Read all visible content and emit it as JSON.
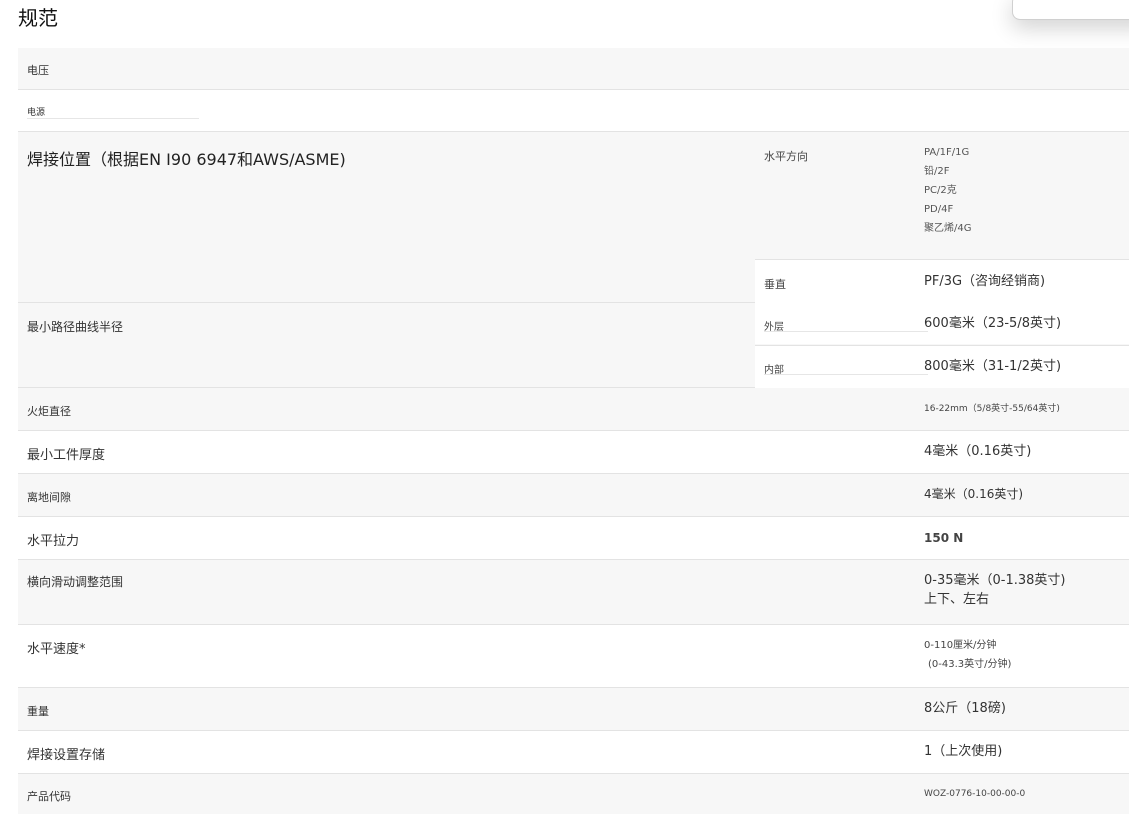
{
  "page": {
    "title": "规范"
  },
  "rows": {
    "voltage": {
      "label": "电压"
    },
    "power": {
      "label": "电源"
    },
    "welding_position": {
      "label": "焊接位置（根据EN I90 6947和AWS/ASME)",
      "horizontal": {
        "sub_label": "水平方向",
        "values": [
          "PA/1F/1G",
          "铅/2F",
          "PC/2克",
          "PD/4F",
          "聚乙烯/4G"
        ]
      },
      "vertical": {
        "sub_label": "垂直",
        "value": "PF/3G（咨询经销商)"
      }
    },
    "min_path_radius": {
      "label": "最小路径曲线半径",
      "outer": {
        "sub_label": "外层",
        "value": "600毫米（23-5/8英寸)"
      },
      "inner": {
        "sub_label": "内部",
        "value": "800毫米（31-1/2英寸)"
      }
    },
    "torch_diameter": {
      "label": "火炬直径",
      "value": "16-22mm（5/8英寸-55/64英寸)"
    },
    "min_workpiece_thickness": {
      "label": "最小工件厚度",
      "value": "4毫米（0.16英寸)"
    },
    "ground_clearance": {
      "label": "离地间隙",
      "value": "4毫米（0.16英寸)"
    },
    "horizontal_pull": {
      "label": "水平拉力",
      "value": "150 N"
    },
    "cross_slide_range": {
      "label": "横向滑动调整范围",
      "value_line1": "0-35毫米（0-1.38英寸)",
      "value_line2": "上下、左右"
    },
    "horizontal_speed": {
      "label": "水平速度*",
      "value_line1": "0-110厘米/分钟",
      "value_line2": "(0-43.3英寸/分钟)"
    },
    "weight": {
      "label": "重量",
      "value": "8公斤（18磅)"
    },
    "weld_settings_storage": {
      "label": "焊接设置存储",
      "value": "1（上次使用)"
    },
    "product_code": {
      "label": "产品代码",
      "value": "WOZ-0776-10-00-00-0"
    }
  }
}
